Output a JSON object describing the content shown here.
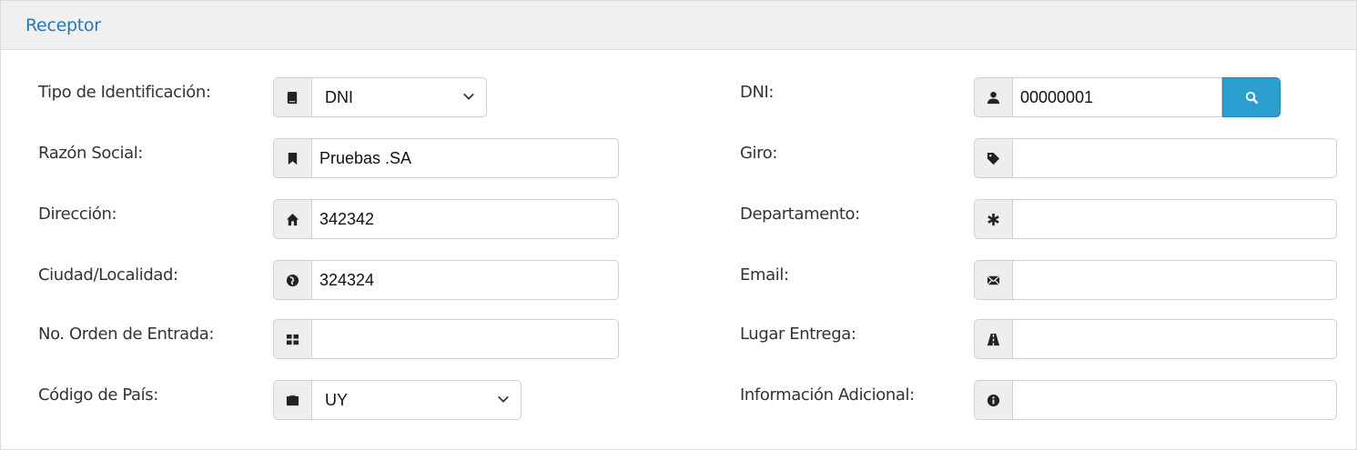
{
  "panel": {
    "title": "Receptor"
  },
  "left": {
    "tipo_identificacion": {
      "label": "Tipo de Identificación:",
      "value": "DNI",
      "icon": "book-icon"
    },
    "razon_social": {
      "label": "Razón Social:",
      "value": "Pruebas .SA",
      "icon": "bookmark-icon"
    },
    "direccion": {
      "label": "Dirección:",
      "value": "342342",
      "icon": "home-icon"
    },
    "ciudad": {
      "label": "Ciudad/Localidad:",
      "value": "324324",
      "icon": "globe-icon"
    },
    "orden_entrada": {
      "label": "No. Orden de Entrada:",
      "value": "",
      "icon": "grid-icon"
    },
    "codigo_pais": {
      "label": "Código de País:",
      "value": "UY",
      "icon": "briefcase-icon"
    }
  },
  "right": {
    "dni": {
      "label": "DNI:",
      "value": "00000001",
      "icon": "user-icon",
      "button_icon": "search-icon"
    },
    "giro": {
      "label": "Giro:",
      "value": "",
      "icon": "tag-icon"
    },
    "departamento": {
      "label": "Departamento:",
      "value": "",
      "icon": "asterisk-icon"
    },
    "email": {
      "label": "Email:",
      "value": "",
      "icon": "envelope-icon"
    },
    "lugar_entrega": {
      "label": "Lugar Entrega:",
      "value": "",
      "icon": "road-icon"
    },
    "info_adicional": {
      "label": "Información Adicional:",
      "value": "",
      "icon": "info-icon"
    }
  },
  "colors": {
    "accent": "#2b9fd0",
    "title": "#1c7cc1",
    "header_bg": "#f0f0f0"
  }
}
